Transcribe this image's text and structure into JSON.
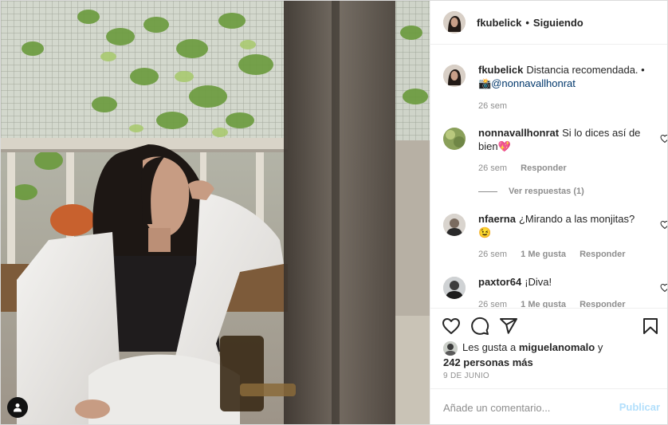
{
  "post": {
    "author": "fkubelick",
    "follow_status": "Siguiendo",
    "separator": "•"
  },
  "comments": [
    {
      "user": "fkubelick",
      "text_before": "Distancia recomendada. •",
      "camera_emoji": "📸",
      "mention": "@nonnavallhonrat",
      "time": "26 sem"
    },
    {
      "user": "nonnavallhonrat",
      "text": "Si lo dices así de bien💖",
      "time": "26 sem",
      "reply": "Responder",
      "view_replies": "Ver respuestas (1)"
    },
    {
      "user": "nfaerna",
      "text": "¿Mirando a las monjitas? 😉",
      "time": "26 sem",
      "likes": "1 Me gusta",
      "reply": "Responder"
    },
    {
      "user": "paxtor64",
      "text": "¡Diva!",
      "time": "26 sem",
      "likes": "1 Me gusta",
      "reply": "Responder"
    }
  ],
  "likes": {
    "prefix": "Les gusta a",
    "user": "miguelanomalo",
    "joiner": "y",
    "others": "242 personas más"
  },
  "date": "9 DE JUNIO",
  "add_comment": {
    "placeholder": "Añade un comentario...",
    "publish": "Publicar"
  },
  "icons": {
    "heart": "heart-icon",
    "comment": "comment-icon",
    "share": "share-icon",
    "save": "bookmark-icon",
    "tag": "user-tag-icon"
  },
  "colors": {
    "link": "#00376b",
    "muted": "#8e8e8e",
    "publish_disabled": "#b2dffc",
    "border": "#dbdbdb"
  }
}
